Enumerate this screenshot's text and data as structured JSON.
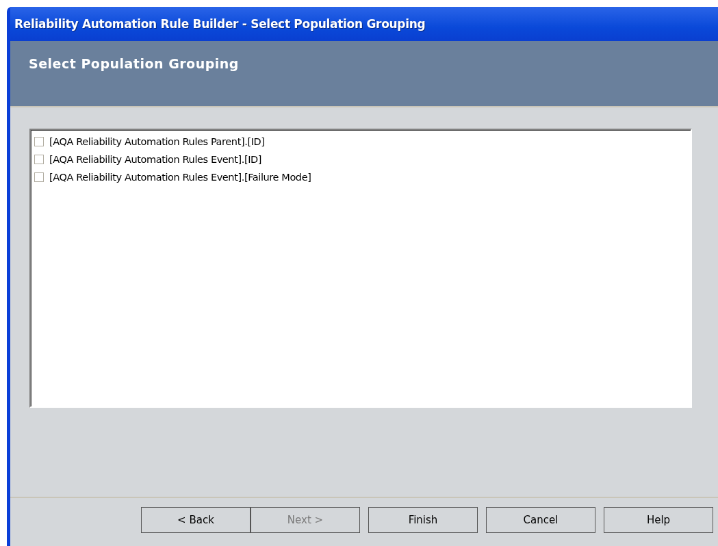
{
  "window": {
    "title": "Reliability Automation Rule Builder - Select Population Grouping"
  },
  "header": {
    "title": "Select Population Grouping"
  },
  "items": [
    {
      "label": "[AQA Reliability Automation Rules Parent].[ID]",
      "checked": false
    },
    {
      "label": "[AQA Reliability Automation Rules Event].[ID]",
      "checked": false
    },
    {
      "label": "[AQA Reliability Automation Rules Event].[Failure Mode]",
      "checked": false
    }
  ],
  "buttons": [
    {
      "label": "< Back",
      "disabled": false
    },
    {
      "label": "Next >",
      "disabled": true
    },
    {
      "label": "Finish",
      "disabled": false
    },
    {
      "label": "Cancel",
      "disabled": false
    },
    {
      "label": "Help",
      "disabled": false
    }
  ]
}
